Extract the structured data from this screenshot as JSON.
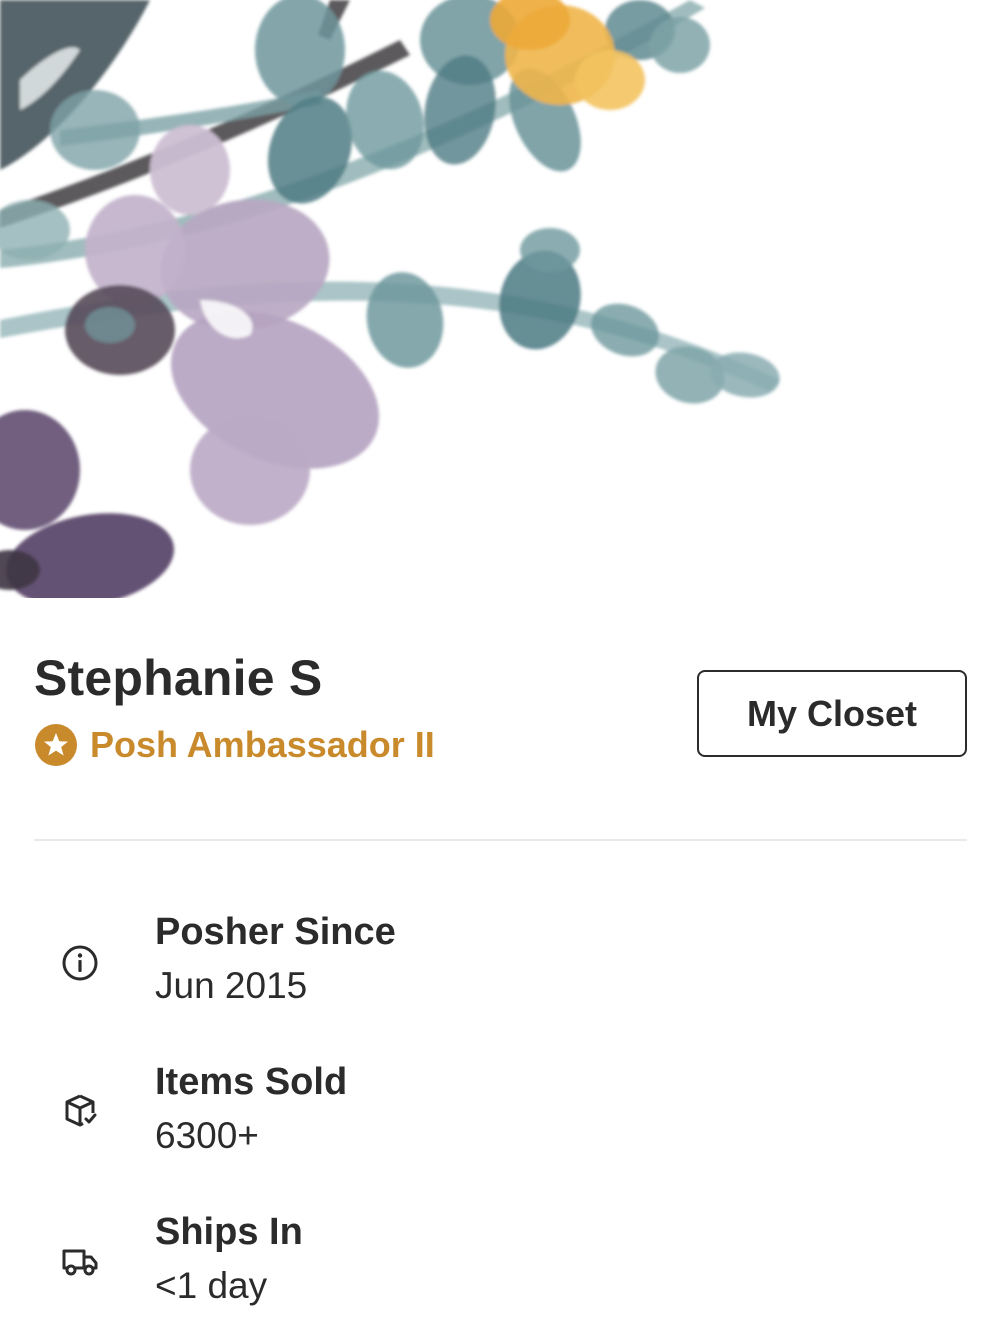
{
  "cover": {
    "image": "watercolor-floral-cover"
  },
  "profile": {
    "name": "Stephanie S",
    "badge": {
      "icon": "star-badge-icon",
      "label": "Posh Ambassador II",
      "color": "#c98a2c"
    },
    "closet_button_label": "My Closet"
  },
  "stats": [
    {
      "icon": "info-icon",
      "label": "Posher Since",
      "value": "Jun 2015"
    },
    {
      "icon": "package-check-icon",
      "label": "Items Sold",
      "value": "6300+"
    },
    {
      "icon": "truck-icon",
      "label": "Ships In",
      "value": "<1 day"
    }
  ]
}
